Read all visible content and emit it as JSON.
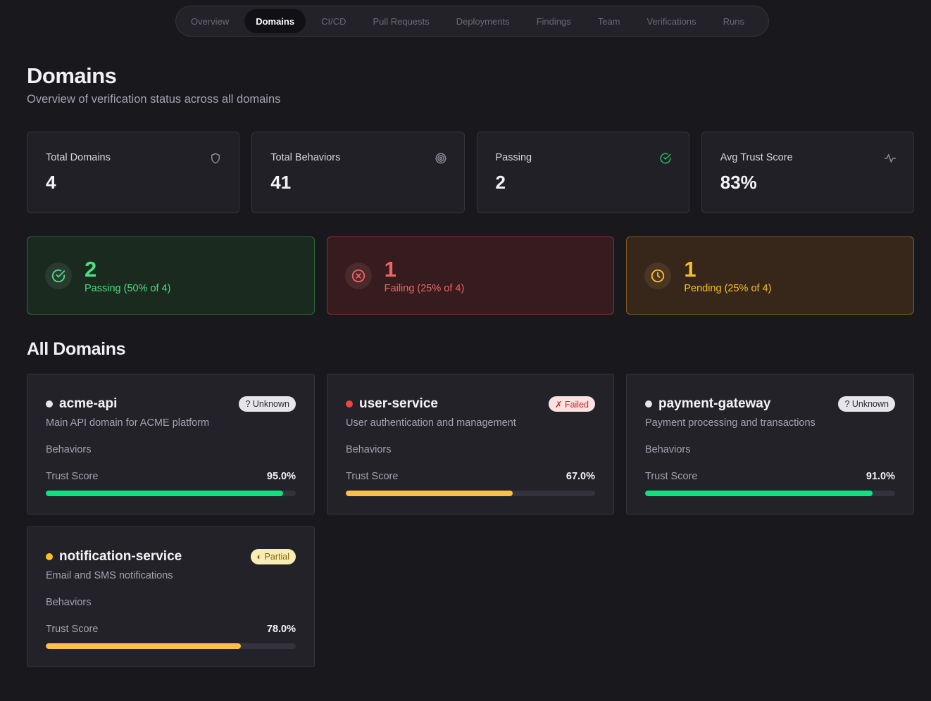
{
  "nav": {
    "tabs": [
      {
        "label": "Overview",
        "active": false
      },
      {
        "label": "Domains",
        "active": true
      },
      {
        "label": "CI/CD",
        "active": false
      },
      {
        "label": "Pull Requests",
        "active": false
      },
      {
        "label": "Deployments",
        "active": false
      },
      {
        "label": "Findings",
        "active": false
      },
      {
        "label": "Team",
        "active": false
      },
      {
        "label": "Verifications",
        "active": false
      },
      {
        "label": "Runs",
        "active": false
      }
    ]
  },
  "header": {
    "title": "Domains",
    "subtitle": "Overview of verification status across all domains"
  },
  "stats": [
    {
      "label": "Total Domains",
      "value": "4",
      "icon": "shield-icon"
    },
    {
      "label": "Total Behaviors",
      "value": "41",
      "icon": "target-icon"
    },
    {
      "label": "Passing",
      "value": "2",
      "icon": "check-circle-icon"
    },
    {
      "label": "Avg Trust Score",
      "value": "83%",
      "icon": "activity-icon"
    }
  ],
  "summary": {
    "passing": {
      "count": "2",
      "text": "Passing (50% of 4)"
    },
    "failing": {
      "count": "1",
      "text": "Failing (25% of 4)"
    },
    "pending": {
      "count": "1",
      "text": "Pending (25% of 4)"
    }
  },
  "domains_section": {
    "title": "All Domains"
  },
  "domains": [
    {
      "name": "acme-api",
      "description": "Main API domain for ACME platform",
      "behaviors_label": "Behaviors",
      "trust_label": "Trust Score",
      "trust_value": "95.0%",
      "trust": 0.95,
      "badge": "? Unknown",
      "status": "unknown",
      "dot_color": "#e6e6ea",
      "bar_color": "#10e07f"
    },
    {
      "name": "user-service",
      "description": "User authentication and management",
      "behaviors_label": "Behaviors",
      "trust_label": "Trust Score",
      "trust_value": "67.0%",
      "trust": 0.67,
      "badge": "✗ Failed",
      "status": "failed",
      "dot_color": "#ef4444",
      "bar_color": "#fbbf4a"
    },
    {
      "name": "payment-gateway",
      "description": "Payment processing and transactions",
      "behaviors_label": "Behaviors",
      "trust_label": "Trust Score",
      "trust_value": "91.0%",
      "trust": 0.91,
      "badge": "? Unknown",
      "status": "unknown",
      "dot_color": "#e6e6ea",
      "bar_color": "#10e07f"
    },
    {
      "name": "notification-service",
      "description": "Email and SMS notifications",
      "behaviors_label": "Behaviors",
      "trust_label": "Trust Score",
      "trust_value": "78.0%",
      "trust": 0.78,
      "badge": "◐ Partial",
      "status": "partial",
      "dot_color": "#fbbf24",
      "bar_color": "#fbbf4a"
    }
  ]
}
